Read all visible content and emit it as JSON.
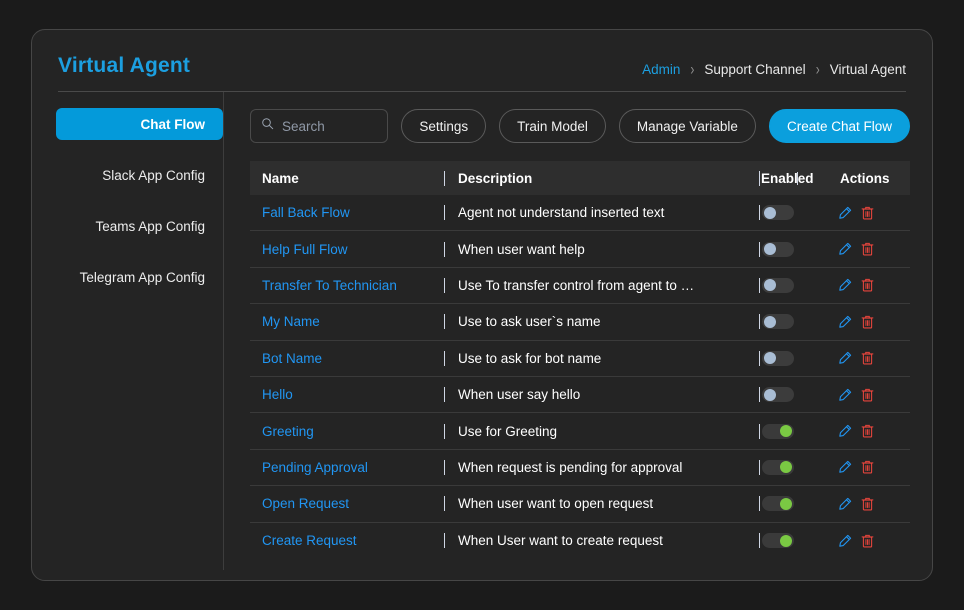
{
  "header": {
    "title": "Virtual Agent",
    "breadcrumb": [
      {
        "label": "Admin",
        "is_link": true
      },
      {
        "label": "Support Channel",
        "is_link": false
      },
      {
        "label": "Virtual Agent",
        "is_link": false
      }
    ],
    "separator_icon": "chevron-right-icon"
  },
  "sidebar": {
    "items": [
      {
        "label": "Chat Flow",
        "active": true
      },
      {
        "label": "Slack App Config",
        "active": false
      },
      {
        "label": "Teams App Config",
        "active": false
      },
      {
        "label": "Telegram App Config",
        "active": false
      }
    ]
  },
  "toolbar": {
    "search": {
      "value": "",
      "placeholder": "Search",
      "icon": "search-icon"
    },
    "buttons": [
      {
        "label": "Settings",
        "primary": false
      },
      {
        "label": "Train Model",
        "primary": false
      },
      {
        "label": "Manage Variable",
        "primary": false
      },
      {
        "label": "Create Chat Flow",
        "primary": true
      }
    ]
  },
  "table": {
    "columns": {
      "name": "Name",
      "description": "Description",
      "enabled": "Enabled",
      "actions": "Actions"
    },
    "rows": [
      {
        "name": "Fall Back Flow",
        "description": "Agent not understand inserted text",
        "enabled": false
      },
      {
        "name": "Help Full Flow",
        "description": "When user want help",
        "enabled": false
      },
      {
        "name": "Transfer To Technician",
        "description": "Use To transfer control from agent to …",
        "enabled": false
      },
      {
        "name": "My Name",
        "description": "Use to ask user`s name",
        "enabled": false
      },
      {
        "name": "Bot Name",
        "description": "Use to ask for bot name",
        "enabled": false
      },
      {
        "name": "Hello",
        "description": "When user say hello",
        "enabled": false
      },
      {
        "name": "Greeting",
        "description": "Use for Greeting",
        "enabled": true
      },
      {
        "name": "Pending Approval",
        "description": "When request is pending for approval",
        "enabled": true
      },
      {
        "name": "Open Request",
        "description": "When user want to open request",
        "enabled": true
      },
      {
        "name": "Create Request",
        "description": "When User want to create request",
        "enabled": true
      }
    ],
    "row_actions": [
      {
        "name": "edit-icon",
        "title": "Edit"
      },
      {
        "name": "delete-icon",
        "title": "Delete"
      }
    ]
  },
  "colors": {
    "accent": "#049ada",
    "link": "#2196f3",
    "toggle_on": "#7ac943",
    "toggle_off_knob": "#a9bdd4",
    "edit_icon": "#2196f3",
    "delete_icon": "#e8453c",
    "card_bg": "#242424",
    "page_bg": "#1b1b1b"
  }
}
